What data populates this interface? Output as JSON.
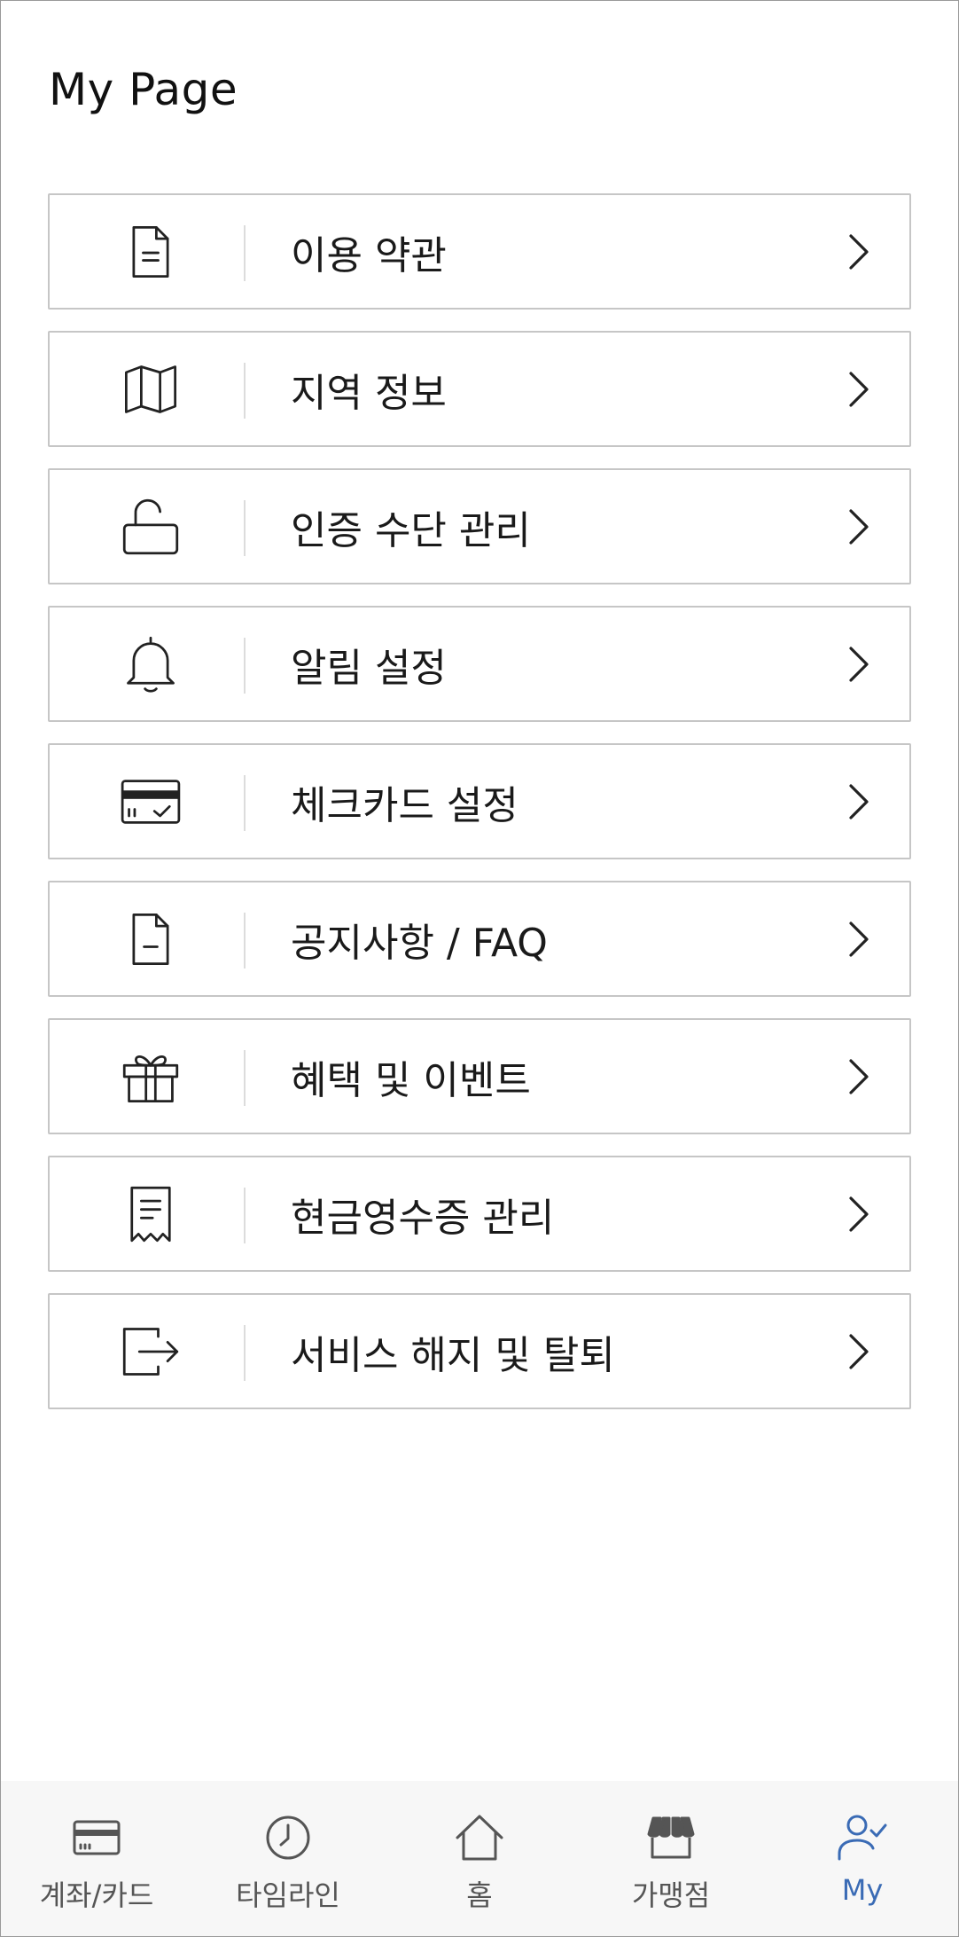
{
  "page": {
    "title": "My Page"
  },
  "menu": {
    "items": [
      {
        "label": "이용 약관",
        "icon": "document-icon"
      },
      {
        "label": "지역 정보",
        "icon": "map-icon"
      },
      {
        "label": "인증 수단 관리",
        "icon": "unlock-icon"
      },
      {
        "label": "알림 설정",
        "icon": "bell-icon"
      },
      {
        "label": "체크카드 설정",
        "icon": "card-check-icon"
      },
      {
        "label": "공지사항 / FAQ",
        "icon": "notice-document-icon"
      },
      {
        "label": "혜택 및 이벤트",
        "icon": "gift-icon"
      },
      {
        "label": "현금영수증 관리",
        "icon": "receipt-icon"
      },
      {
        "label": "서비스 해지 및 탈퇴",
        "icon": "logout-icon"
      }
    ],
    "chevron_icon": "chevron-right-icon"
  },
  "bottom_nav": {
    "items": [
      {
        "label": "계좌/카드",
        "icon": "card-icon",
        "active": false
      },
      {
        "label": "타임라인",
        "icon": "clock-icon",
        "active": false
      },
      {
        "label": "홈",
        "icon": "home-icon",
        "active": false
      },
      {
        "label": "가맹점",
        "icon": "store-icon",
        "active": false
      },
      {
        "label": "My",
        "icon": "user-check-icon",
        "active": true
      }
    ]
  },
  "colors": {
    "active": "#3a6bb5",
    "inactive": "#555555",
    "border": "#c6c6c6",
    "icon": "#222222"
  }
}
